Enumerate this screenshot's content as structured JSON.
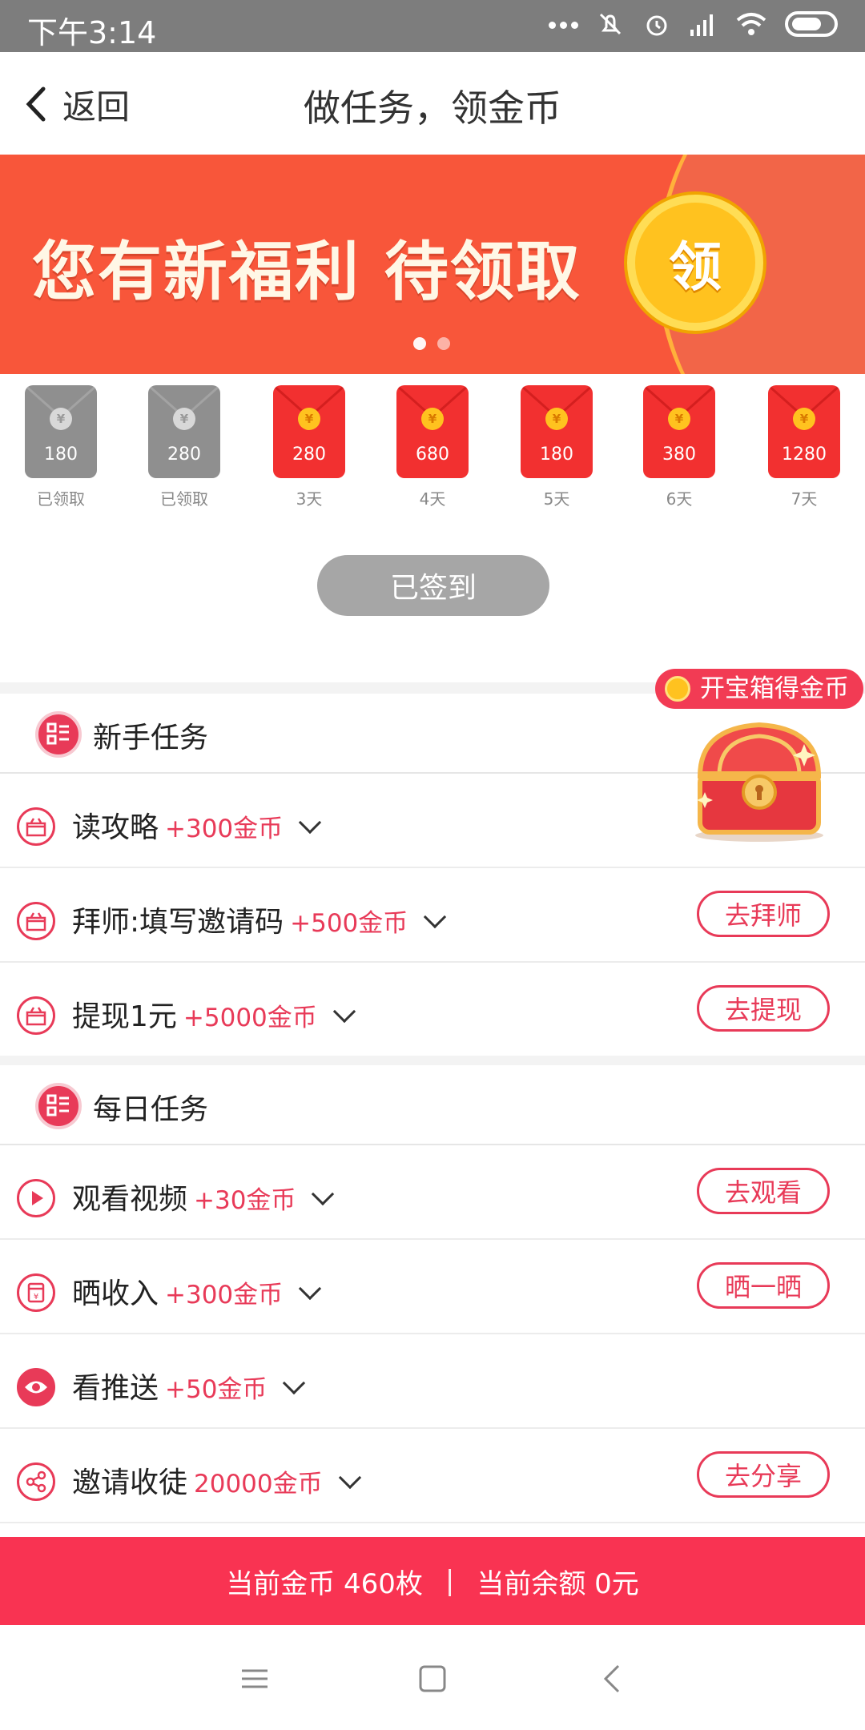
{
  "status_bar": {
    "time": "下午3:14"
  },
  "nav": {
    "back_label": "返回",
    "title": "做任务，领金币"
  },
  "banner": {
    "slogan": "您有新福利 待领取",
    "coin_label": "领",
    "page_index": 1,
    "page_count": 2
  },
  "envelopes": [
    {
      "amount": "180",
      "label": "已领取",
      "claimed": true
    },
    {
      "amount": "280",
      "label": "已领取",
      "claimed": true
    },
    {
      "amount": "280",
      "label": "3天",
      "claimed": false
    },
    {
      "amount": "680",
      "label": "4天",
      "claimed": false
    },
    {
      "amount": "180",
      "label": "5天",
      "claimed": false
    },
    {
      "amount": "380",
      "label": "6天",
      "claimed": false
    },
    {
      "amount": "1280",
      "label": "7天",
      "claimed": false
    }
  ],
  "envelope_coin_symbol": "¥",
  "signin": {
    "label": "已签到"
  },
  "treasure": {
    "label": "开宝箱得金币"
  },
  "newbie": {
    "title": "新手任务",
    "tasks": [
      {
        "name": "读攻略",
        "reward": "+300金币",
        "icon": "gift-icon",
        "button": ""
      },
      {
        "name": "拜师:填写邀请码",
        "reward": "+500金币",
        "icon": "gift-icon",
        "button": "去拜师"
      },
      {
        "name": "提现1元",
        "reward": "+5000金币",
        "icon": "gift-icon",
        "button": "去提现"
      }
    ]
  },
  "daily": {
    "title": "每日任务",
    "tasks": [
      {
        "name": "观看视频",
        "reward": "+30金币",
        "icon": "play-icon",
        "button": "去观看"
      },
      {
        "name": "晒收入",
        "reward": "+300金币",
        "icon": "wallet-icon",
        "button": "晒一晒"
      },
      {
        "name": "看推送",
        "reward": "+50金币",
        "icon": "eye-icon",
        "button": ""
      },
      {
        "name": "邀请收徒",
        "reward": "20000金币",
        "icon": "share-icon",
        "button": "去分享"
      }
    ]
  },
  "bottom_bar": {
    "coins": "当前金币 460枚",
    "divider": "|",
    "balance": "当前余额 0元"
  },
  "colors": {
    "accent": "#e83a58",
    "banner": "#f8563a",
    "bottom_bar": "#f93352"
  }
}
